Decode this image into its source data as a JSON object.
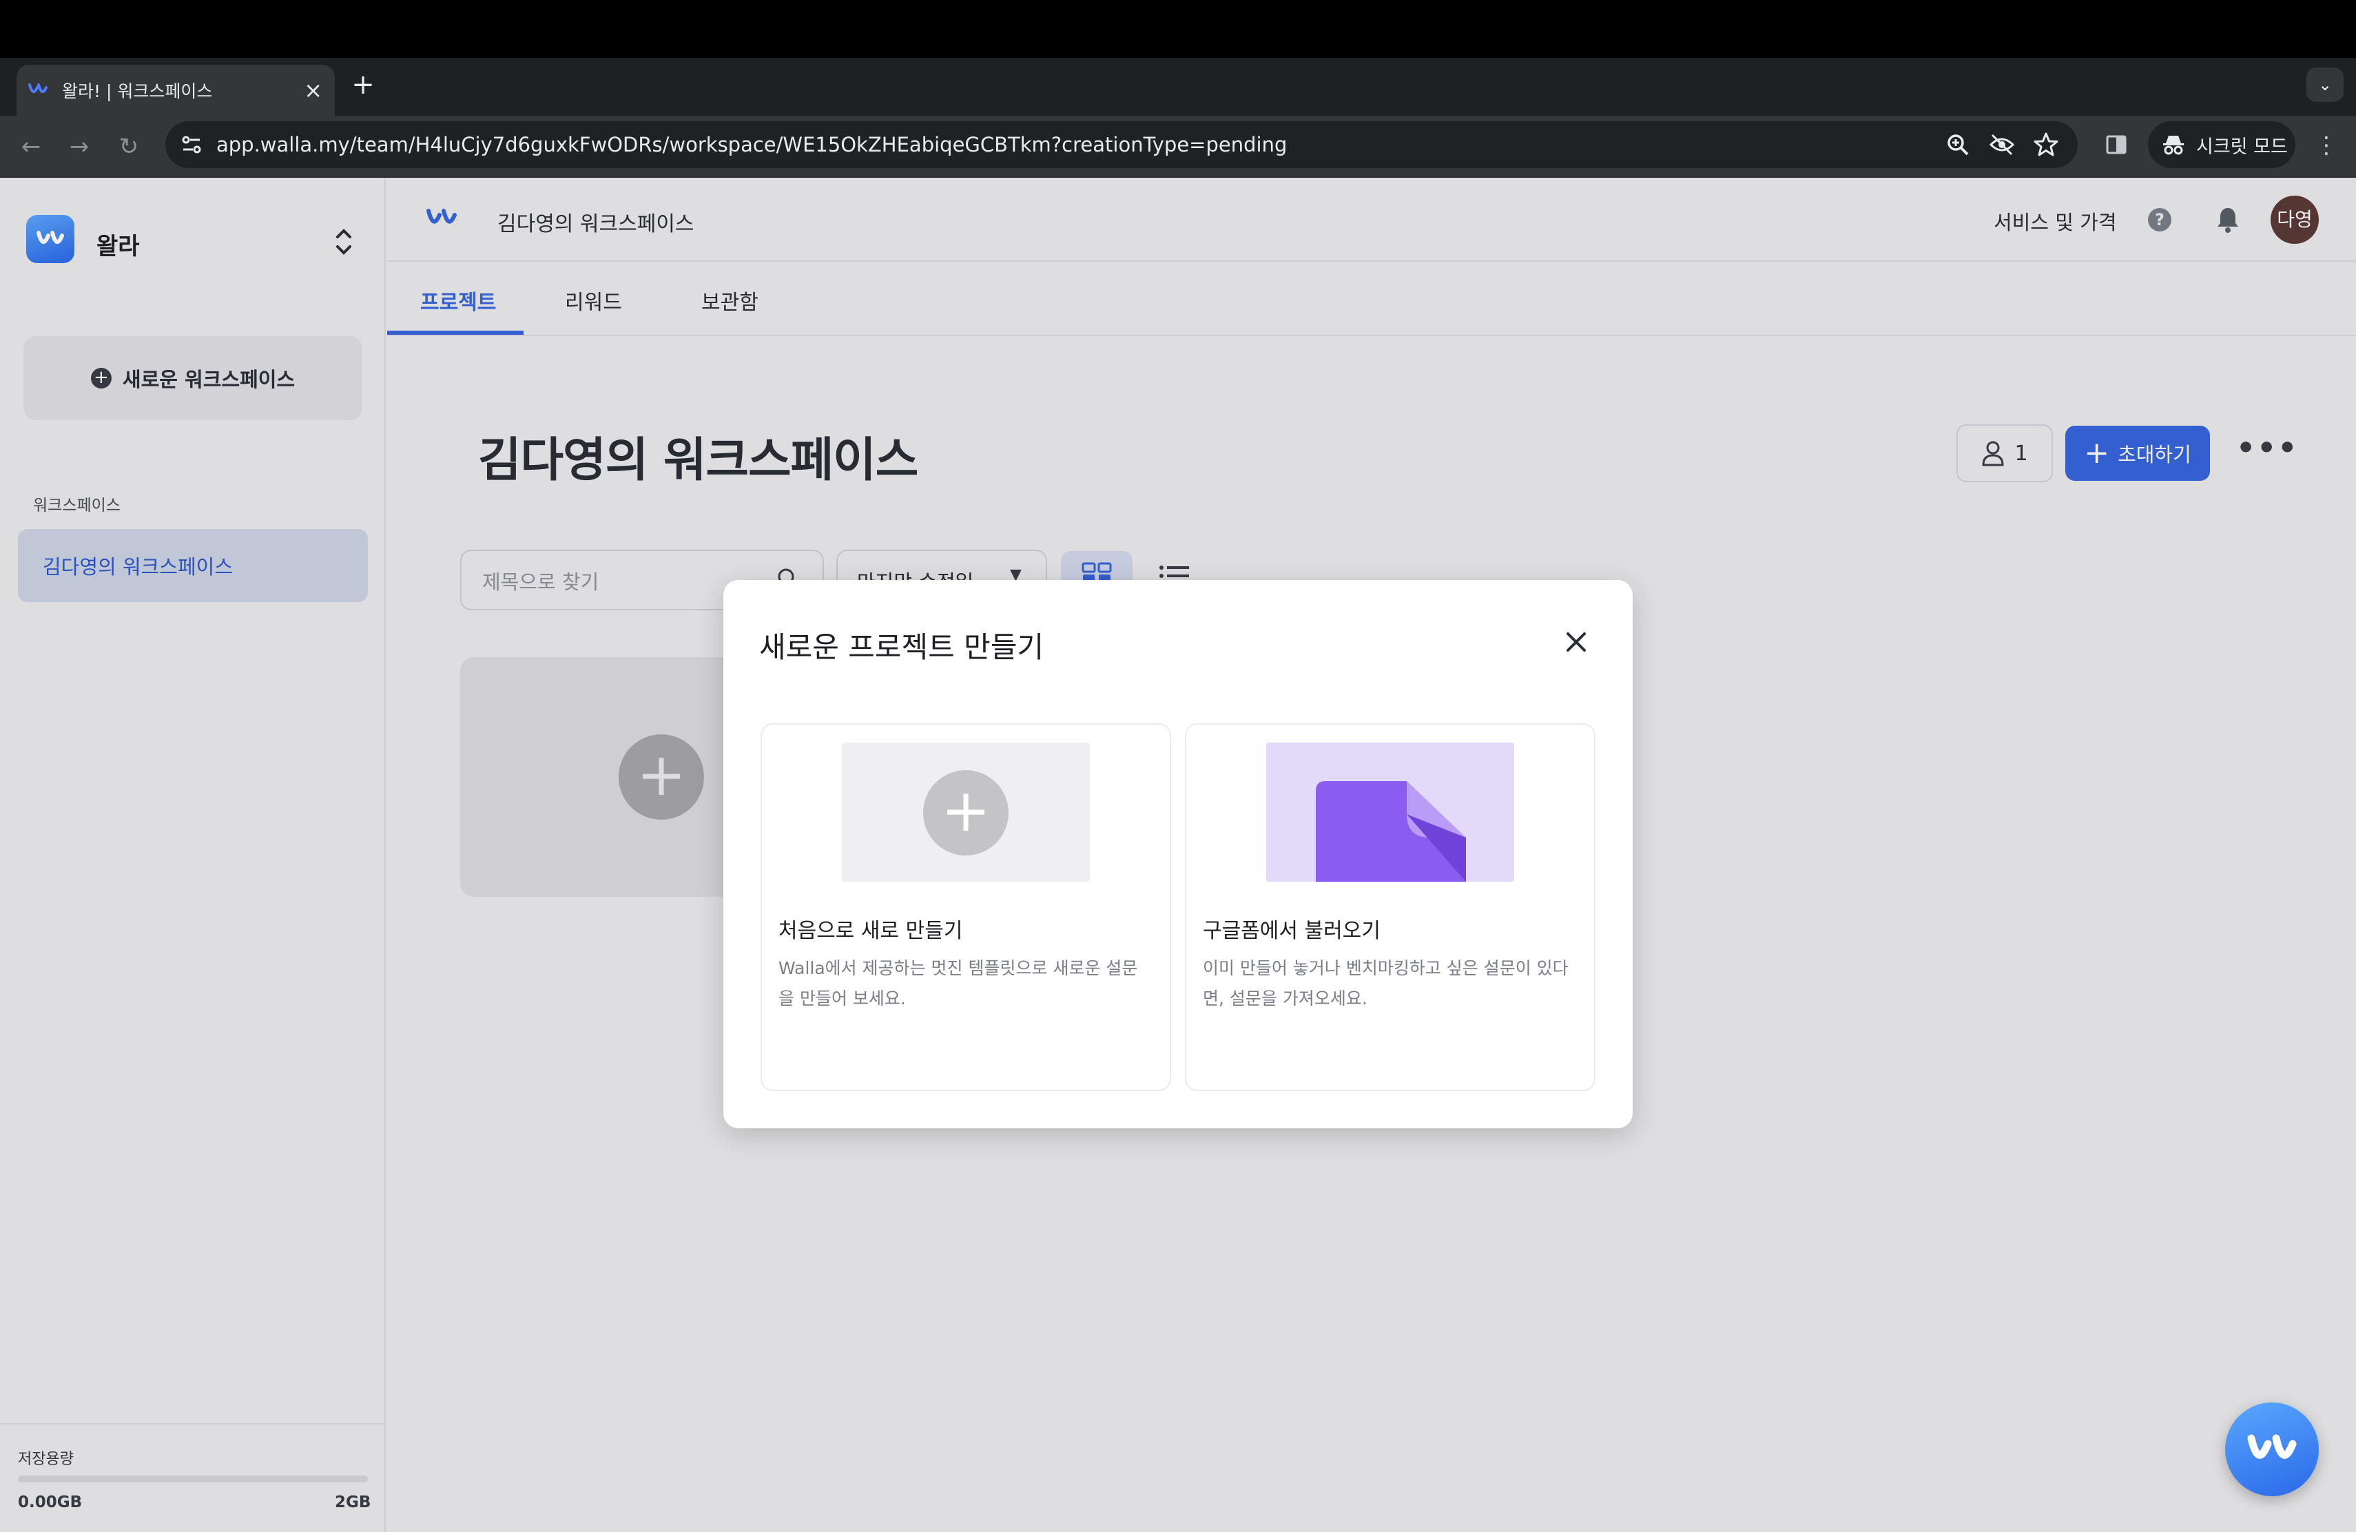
{
  "browser": {
    "tab_title": "왈라! | 워크스페이스",
    "url": "app.walla.my/team/H4luCjy7d6guxkFwODRs/workspace/WE15OkZHEabiqeGCBTkm?creationType=pending",
    "incognito_label": "시크릿 모드"
  },
  "sidebar": {
    "app_name": "왈라",
    "new_workspace_label": "새로운 워크스페이스",
    "section_label": "워크스페이스",
    "workspaces": [
      {
        "label": "김다영의 워크스페이스",
        "active": true
      }
    ],
    "storage": {
      "label": "저장용량",
      "used": "0.00GB",
      "total": "2GB",
      "used_fraction": 0
    }
  },
  "header": {
    "workspace_name": "김다영의 워크스페이스",
    "pricing_label": "서비스 및 가격",
    "avatar_text": "다영"
  },
  "tabs": [
    {
      "label": "프로젝트",
      "active": true
    },
    {
      "label": "리워드",
      "active": false
    },
    {
      "label": "보관함",
      "active": false
    }
  ],
  "main": {
    "title": "김다영의 워크스페이스",
    "member_count": "1",
    "invite_label": "초대하기",
    "search_placeholder": "제목으로 찾기",
    "sort_label": "마지막 수정일"
  },
  "modal": {
    "title": "새로운 프로젝트 만들기",
    "options": [
      {
        "title": "처음으로 새로 만들기",
        "description": "Walla에서 제공하는 멋진 템플릿으로 새로운 설문을 만들어 보세요."
      },
      {
        "title": "구글폼에서 불러오기",
        "description": "이미 만들어 놓거나 벤치마킹하고 싶은 설문이 있다면, 설문을 가져오세요."
      }
    ]
  },
  "colors": {
    "accent": "#3865dd",
    "active_item_bg": "#cdd5e5",
    "thumb_purple": "#8b5cf0"
  }
}
